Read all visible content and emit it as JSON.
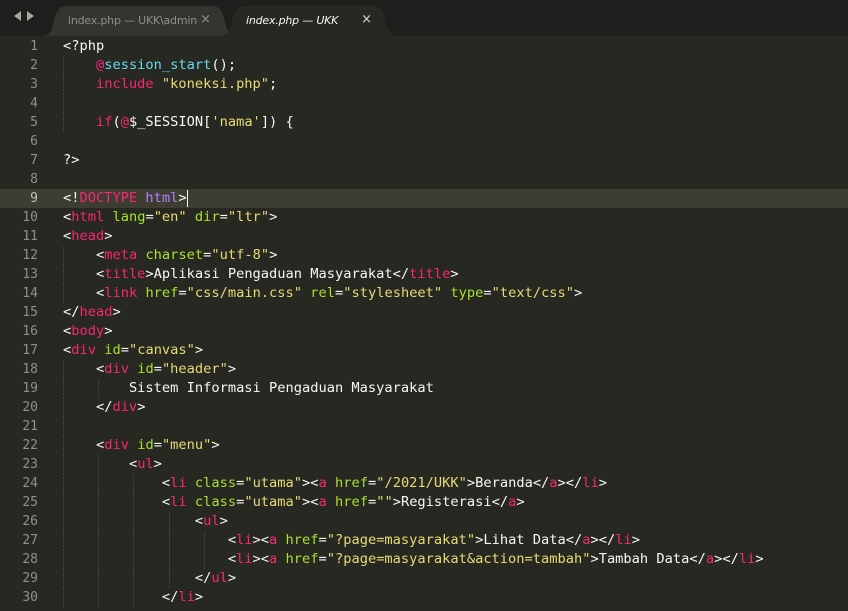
{
  "tabs": [
    {
      "label": "index.php — UKK\\admin",
      "close": "×",
      "active": false
    },
    {
      "label": "index.php — UKK",
      "close": "×",
      "active": true
    }
  ],
  "icons": {
    "nav_back": "chevron-left-icon",
    "nav_forward": "chevron-right-icon",
    "close": "close-icon"
  },
  "colors": {
    "background": "#272822",
    "tabbar": "#1e1f1c",
    "tag": "#f92672",
    "attribute": "#a6e22e",
    "string": "#e6db74",
    "function": "#66d9ef",
    "constant": "#ae81ff",
    "text": "#f8f8f2",
    "line_number": "#90908a",
    "current_line": "#3e3d32"
  },
  "editor": {
    "current_line": 9,
    "cursor_line": 9,
    "lines": [
      {
        "n": "1",
        "indent": 0,
        "tokens": [
          {
            "t": "<?php",
            "c": "default"
          }
        ]
      },
      {
        "n": "2",
        "indent": 1,
        "tokens": [
          {
            "t": "@",
            "c": "keyword"
          },
          {
            "t": "session_start",
            "c": "func"
          },
          {
            "t": "();",
            "c": "default"
          }
        ]
      },
      {
        "n": "3",
        "indent": 1,
        "tokens": [
          {
            "t": "include",
            "c": "keyword"
          },
          {
            "t": " ",
            "c": "default"
          },
          {
            "t": "\"koneksi.php\"",
            "c": "string"
          },
          {
            "t": ";",
            "c": "default"
          }
        ]
      },
      {
        "n": "4",
        "indent": 1,
        "tokens": []
      },
      {
        "n": "5",
        "indent": 1,
        "tokens": [
          {
            "t": "if",
            "c": "keyword"
          },
          {
            "t": "(",
            "c": "default"
          },
          {
            "t": "@",
            "c": "keyword"
          },
          {
            "t": "$_SESSION[",
            "c": "default"
          },
          {
            "t": "'nama'",
            "c": "string"
          },
          {
            "t": "]) {",
            "c": "default"
          }
        ]
      },
      {
        "n": "6",
        "indent": 0,
        "tokens": []
      },
      {
        "n": "7",
        "indent": 0,
        "tokens": [
          {
            "t": "?>",
            "c": "default"
          }
        ]
      },
      {
        "n": "8",
        "indent": 0,
        "tokens": []
      },
      {
        "n": "9",
        "indent": 0,
        "tokens": [
          {
            "t": "<!",
            "c": "default"
          },
          {
            "t": "DOCTYPE",
            "c": "tag"
          },
          {
            "t": " ",
            "c": "default"
          },
          {
            "t": "html",
            "c": "const"
          },
          {
            "t": ">",
            "c": "default"
          }
        ]
      },
      {
        "n": "10",
        "indent": 0,
        "tokens": [
          {
            "t": "<",
            "c": "default"
          },
          {
            "t": "html",
            "c": "tag"
          },
          {
            "t": " ",
            "c": "default"
          },
          {
            "t": "lang",
            "c": "attr"
          },
          {
            "t": "=",
            "c": "default"
          },
          {
            "t": "\"en\"",
            "c": "string"
          },
          {
            "t": " ",
            "c": "default"
          },
          {
            "t": "dir",
            "c": "attr"
          },
          {
            "t": "=",
            "c": "default"
          },
          {
            "t": "\"ltr\"",
            "c": "string"
          },
          {
            "t": ">",
            "c": "default"
          }
        ]
      },
      {
        "n": "11",
        "indent": 0,
        "tokens": [
          {
            "t": "<",
            "c": "default"
          },
          {
            "t": "head",
            "c": "tag"
          },
          {
            "t": ">",
            "c": "default"
          }
        ]
      },
      {
        "n": "12",
        "indent": 1,
        "tokens": [
          {
            "t": "<",
            "c": "default"
          },
          {
            "t": "meta",
            "c": "tag"
          },
          {
            "t": " ",
            "c": "default"
          },
          {
            "t": "charset",
            "c": "attr"
          },
          {
            "t": "=",
            "c": "default"
          },
          {
            "t": "\"utf-8\"",
            "c": "string"
          },
          {
            "t": ">",
            "c": "default"
          }
        ]
      },
      {
        "n": "13",
        "indent": 1,
        "tokens": [
          {
            "t": "<",
            "c": "default"
          },
          {
            "t": "title",
            "c": "tag"
          },
          {
            "t": ">",
            "c": "default"
          },
          {
            "t": "Aplikasi Pengaduan Masyarakat",
            "c": "text"
          },
          {
            "t": "</",
            "c": "default"
          },
          {
            "t": "title",
            "c": "tag"
          },
          {
            "t": ">",
            "c": "default"
          }
        ]
      },
      {
        "n": "14",
        "indent": 1,
        "tokens": [
          {
            "t": "<",
            "c": "default"
          },
          {
            "t": "link",
            "c": "tag"
          },
          {
            "t": " ",
            "c": "default"
          },
          {
            "t": "href",
            "c": "attr"
          },
          {
            "t": "=",
            "c": "default"
          },
          {
            "t": "\"css/main.css\"",
            "c": "string"
          },
          {
            "t": " ",
            "c": "default"
          },
          {
            "t": "rel",
            "c": "attr"
          },
          {
            "t": "=",
            "c": "default"
          },
          {
            "t": "\"stylesheet\"",
            "c": "string"
          },
          {
            "t": " ",
            "c": "default"
          },
          {
            "t": "type",
            "c": "attr"
          },
          {
            "t": "=",
            "c": "default"
          },
          {
            "t": "\"text/css\"",
            "c": "string"
          },
          {
            "t": ">",
            "c": "default"
          }
        ]
      },
      {
        "n": "15",
        "indent": 0,
        "tokens": [
          {
            "t": "</",
            "c": "default"
          },
          {
            "t": "head",
            "c": "tag"
          },
          {
            "t": ">",
            "c": "default"
          }
        ]
      },
      {
        "n": "16",
        "indent": 0,
        "tokens": [
          {
            "t": "<",
            "c": "default"
          },
          {
            "t": "body",
            "c": "tag"
          },
          {
            "t": ">",
            "c": "default"
          }
        ]
      },
      {
        "n": "17",
        "indent": 0,
        "tokens": [
          {
            "t": "<",
            "c": "default"
          },
          {
            "t": "div",
            "c": "tag"
          },
          {
            "t": " ",
            "c": "default"
          },
          {
            "t": "id",
            "c": "attr"
          },
          {
            "t": "=",
            "c": "default"
          },
          {
            "t": "\"canvas\"",
            "c": "string"
          },
          {
            "t": ">",
            "c": "default"
          }
        ]
      },
      {
        "n": "18",
        "indent": 1,
        "tokens": [
          {
            "t": "<",
            "c": "default"
          },
          {
            "t": "div",
            "c": "tag"
          },
          {
            "t": " ",
            "c": "default"
          },
          {
            "t": "id",
            "c": "attr"
          },
          {
            "t": "=",
            "c": "default"
          },
          {
            "t": "\"header\"",
            "c": "string"
          },
          {
            "t": ">",
            "c": "default"
          }
        ]
      },
      {
        "n": "19",
        "indent": 2,
        "tokens": [
          {
            "t": "Sistem Informasi Pengaduan Masyarakat",
            "c": "text"
          }
        ]
      },
      {
        "n": "20",
        "indent": 1,
        "tokens": [
          {
            "t": "</",
            "c": "default"
          },
          {
            "t": "div",
            "c": "tag"
          },
          {
            "t": ">",
            "c": "default"
          }
        ]
      },
      {
        "n": "21",
        "indent": 1,
        "tokens": []
      },
      {
        "n": "22",
        "indent": 1,
        "tokens": [
          {
            "t": "<",
            "c": "default"
          },
          {
            "t": "div",
            "c": "tag"
          },
          {
            "t": " ",
            "c": "default"
          },
          {
            "t": "id",
            "c": "attr"
          },
          {
            "t": "=",
            "c": "default"
          },
          {
            "t": "\"menu\"",
            "c": "string"
          },
          {
            "t": ">",
            "c": "default"
          }
        ]
      },
      {
        "n": "23",
        "indent": 2,
        "tokens": [
          {
            "t": "<",
            "c": "default"
          },
          {
            "t": "ul",
            "c": "tag"
          },
          {
            "t": ">",
            "c": "default"
          }
        ]
      },
      {
        "n": "24",
        "indent": 3,
        "tokens": [
          {
            "t": "<",
            "c": "default"
          },
          {
            "t": "li",
            "c": "tag"
          },
          {
            "t": " ",
            "c": "default"
          },
          {
            "t": "class",
            "c": "attr"
          },
          {
            "t": "=",
            "c": "default"
          },
          {
            "t": "\"utama\"",
            "c": "string"
          },
          {
            "t": "><",
            "c": "default"
          },
          {
            "t": "a",
            "c": "tag"
          },
          {
            "t": " ",
            "c": "default"
          },
          {
            "t": "href",
            "c": "attr"
          },
          {
            "t": "=",
            "c": "default"
          },
          {
            "t": "\"/2021/UKK\"",
            "c": "string"
          },
          {
            "t": ">",
            "c": "default"
          },
          {
            "t": "Beranda",
            "c": "text"
          },
          {
            "t": "</",
            "c": "default"
          },
          {
            "t": "a",
            "c": "tag"
          },
          {
            "t": "></",
            "c": "default"
          },
          {
            "t": "li",
            "c": "tag"
          },
          {
            "t": ">",
            "c": "default"
          }
        ]
      },
      {
        "n": "25",
        "indent": 3,
        "tokens": [
          {
            "t": "<",
            "c": "default"
          },
          {
            "t": "li",
            "c": "tag"
          },
          {
            "t": " ",
            "c": "default"
          },
          {
            "t": "class",
            "c": "attr"
          },
          {
            "t": "=",
            "c": "default"
          },
          {
            "t": "\"utama\"",
            "c": "string"
          },
          {
            "t": "><",
            "c": "default"
          },
          {
            "t": "a",
            "c": "tag"
          },
          {
            "t": " ",
            "c": "default"
          },
          {
            "t": "href",
            "c": "attr"
          },
          {
            "t": "=",
            "c": "default"
          },
          {
            "t": "\"\"",
            "c": "string"
          },
          {
            "t": ">",
            "c": "default"
          },
          {
            "t": "Registerasi",
            "c": "text"
          },
          {
            "t": "</",
            "c": "default"
          },
          {
            "t": "a",
            "c": "tag"
          },
          {
            "t": ">",
            "c": "default"
          }
        ]
      },
      {
        "n": "26",
        "indent": 4,
        "tokens": [
          {
            "t": "<",
            "c": "default"
          },
          {
            "t": "ul",
            "c": "tag"
          },
          {
            "t": ">",
            "c": "default"
          }
        ]
      },
      {
        "n": "27",
        "indent": 5,
        "tokens": [
          {
            "t": "<",
            "c": "default"
          },
          {
            "t": "li",
            "c": "tag"
          },
          {
            "t": "><",
            "c": "default"
          },
          {
            "t": "a",
            "c": "tag"
          },
          {
            "t": " ",
            "c": "default"
          },
          {
            "t": "href",
            "c": "attr"
          },
          {
            "t": "=",
            "c": "default"
          },
          {
            "t": "\"?page=masyarakat\"",
            "c": "string"
          },
          {
            "t": ">",
            "c": "default"
          },
          {
            "t": "Lihat Data",
            "c": "text"
          },
          {
            "t": "</",
            "c": "default"
          },
          {
            "t": "a",
            "c": "tag"
          },
          {
            "t": "></",
            "c": "default"
          },
          {
            "t": "li",
            "c": "tag"
          },
          {
            "t": ">",
            "c": "default"
          }
        ]
      },
      {
        "n": "28",
        "indent": 5,
        "tokens": [
          {
            "t": "<",
            "c": "default"
          },
          {
            "t": "li",
            "c": "tag"
          },
          {
            "t": "><",
            "c": "default"
          },
          {
            "t": "a",
            "c": "tag"
          },
          {
            "t": " ",
            "c": "default"
          },
          {
            "t": "href",
            "c": "attr"
          },
          {
            "t": "=",
            "c": "default"
          },
          {
            "t": "\"?page=masyarakat&action=tambah\"",
            "c": "string"
          },
          {
            "t": ">",
            "c": "default"
          },
          {
            "t": "Tambah Data",
            "c": "text"
          },
          {
            "t": "</",
            "c": "default"
          },
          {
            "t": "a",
            "c": "tag"
          },
          {
            "t": "></",
            "c": "default"
          },
          {
            "t": "li",
            "c": "tag"
          },
          {
            "t": ">",
            "c": "default"
          }
        ]
      },
      {
        "n": "29",
        "indent": 4,
        "tokens": [
          {
            "t": "</",
            "c": "default"
          },
          {
            "t": "ul",
            "c": "tag"
          },
          {
            "t": ">",
            "c": "default"
          }
        ]
      },
      {
        "n": "30",
        "indent": 3,
        "tokens": [
          {
            "t": "</",
            "c": "default"
          },
          {
            "t": "li",
            "c": "tag"
          },
          {
            "t": ">",
            "c": "default"
          }
        ]
      }
    ]
  }
}
